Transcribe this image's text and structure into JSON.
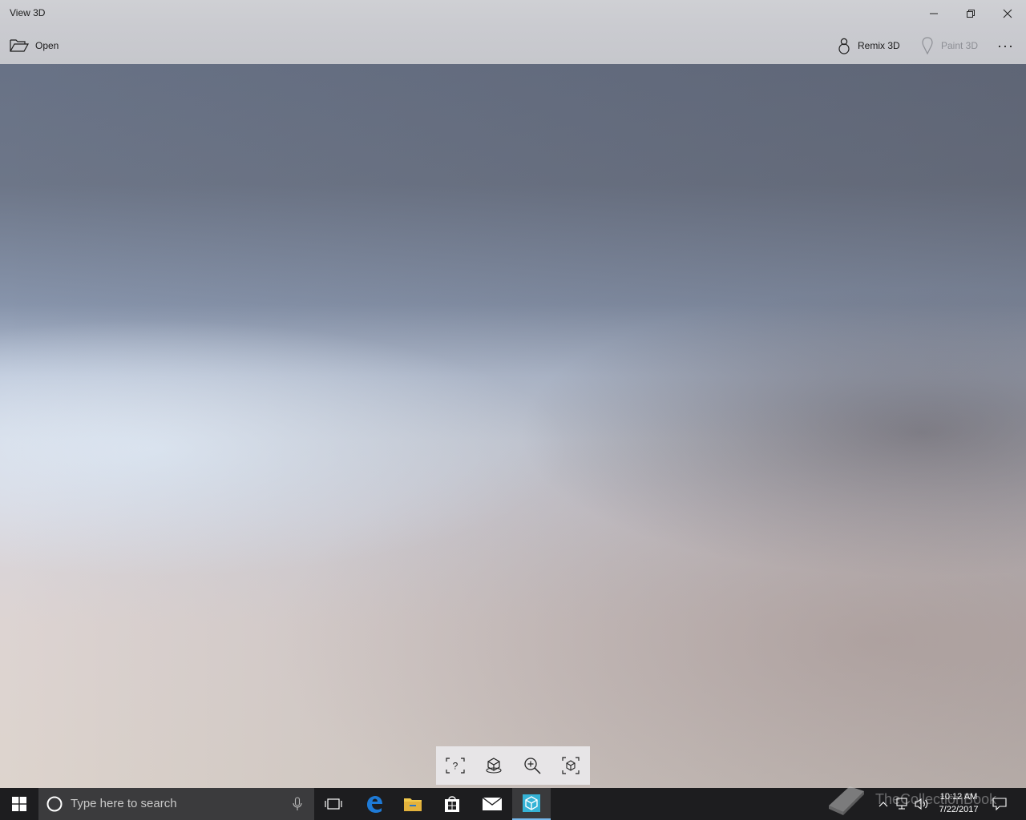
{
  "window": {
    "title": "View 3D"
  },
  "commandbar": {
    "open_label": "Open",
    "remix_label": "Remix 3D",
    "paint_label": "Paint 3D",
    "more_label": "···"
  },
  "toolbox": {
    "tools": [
      {
        "icon": "help-frame-icon"
      },
      {
        "icon": "environment-icon"
      },
      {
        "icon": "zoom-in-icon"
      },
      {
        "icon": "reset-view-cube-icon"
      }
    ]
  },
  "taskbar": {
    "search_placeholder": "Type here to search",
    "watermark_text": "TheCollectionBook",
    "time": "10:12 AM",
    "date": "7/22/2017",
    "colors": {
      "background": "#1d1d1f",
      "edge_blue": "#1e7ad6",
      "explorer_yellow": "#f2c94c",
      "view3d_teal": "#35b3d6"
    }
  }
}
